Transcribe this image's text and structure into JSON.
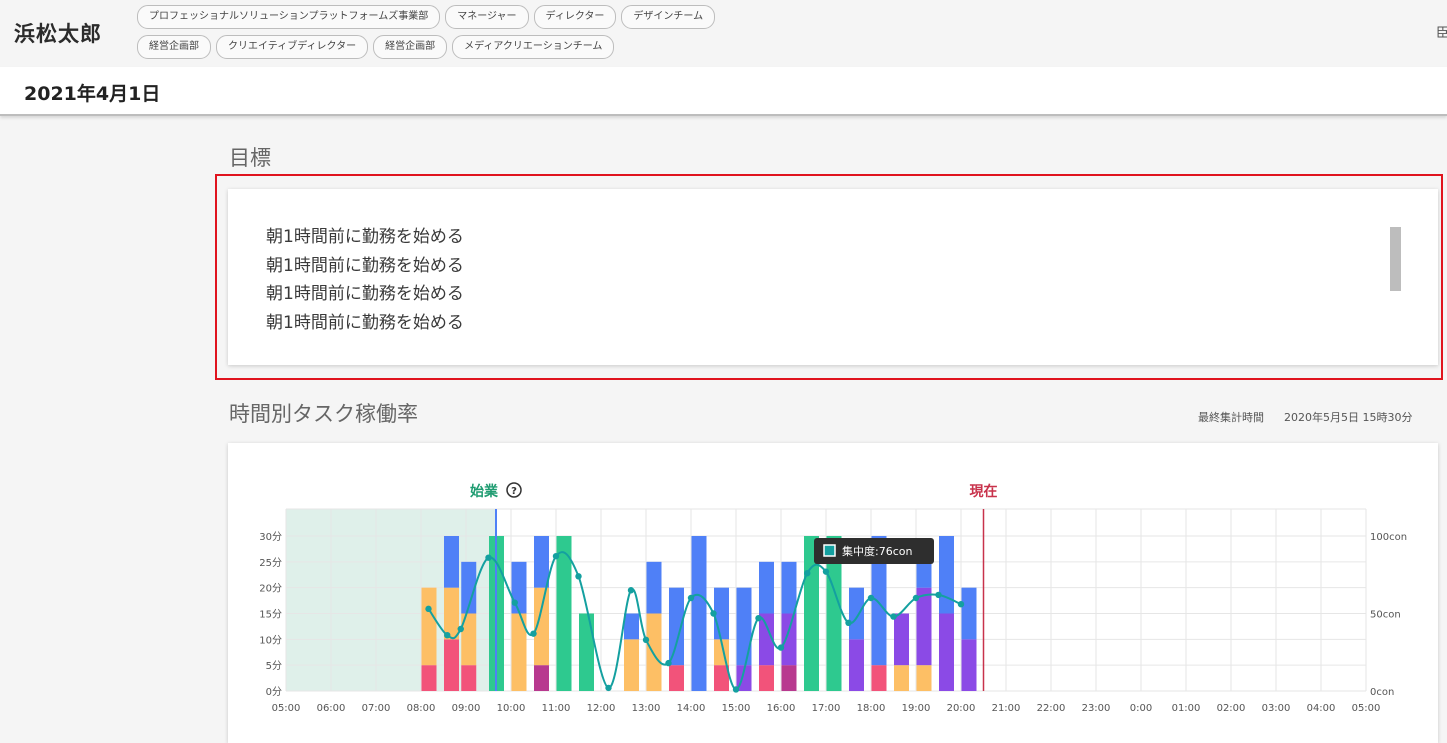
{
  "header": {
    "user_name": "浜松太郎",
    "tags_row1": [
      "プロフェッショナルソリューションプラットフォームズ事業部",
      "マネージャー",
      "ディレクター",
      "デザインチーム"
    ],
    "tags_row2": [
      "経営企画部",
      "クリエイティブディレクター",
      "経営企画部",
      "メディアクリエーションチーム"
    ],
    "edge_glyph": "臣"
  },
  "date": "2021年4月1日",
  "goals": {
    "title": "目標",
    "items": [
      "朝1時間前に勤務を始める",
      "朝1時間前に勤務を始める",
      "朝1時間前に勤務を始める",
      "朝1時間前に勤務を始める"
    ]
  },
  "task_rate": {
    "title": "時間別タスク稼働率",
    "last_updated_label": "最終集計時間",
    "last_updated_value": "2020年5月5日 15時30分"
  },
  "colors": {
    "pink": "#f2537a",
    "orange": "#fdbf65",
    "blue": "#4f80f7",
    "green": "#2ec98f",
    "purple": "#8b4ae6",
    "magenta": "#b8398f",
    "teal": "#14a0a0",
    "shade": "#dff0ea",
    "start_marker": "#1f9c71",
    "now_marker": "#c8324b"
  },
  "chart_data": {
    "type": "bar",
    "markers": {
      "start_label": "始業",
      "start_help_icon": "question-circle-icon",
      "start_time": "09:40",
      "now_label": "現在",
      "now_time": "20:30"
    },
    "tooltip": "集中度:76con",
    "x_ticks": [
      "05:00",
      "06:00",
      "07:00",
      "08:00",
      "09:00",
      "10:00",
      "11:00",
      "12:00",
      "13:00",
      "14:00",
      "15:00",
      "16:00",
      "17:00",
      "18:00",
      "19:00",
      "20:00",
      "21:00",
      "22:00",
      "23:00",
      "0:00",
      "01:00",
      "02:00",
      "03:00",
      "04:00",
      "05:00"
    ],
    "y_left_ticks": [
      "0分",
      "5分",
      "10分",
      "15分",
      "20分",
      "25分",
      "30分"
    ],
    "y_left_range": [
      0,
      30
    ],
    "y_right_ticks": [
      "0con",
      "50con",
      "100con"
    ],
    "y_right_range": [
      0,
      100
    ],
    "shaded_until": "09:40",
    "bars": [
      {
        "time": "08:00",
        "segments": [
          [
            "pink",
            5
          ],
          [
            "orange",
            15
          ]
        ]
      },
      {
        "time": "08:30",
        "segments": [
          [
            "pink",
            10
          ],
          [
            "orange",
            10
          ],
          [
            "blue",
            10
          ]
        ]
      },
      {
        "time": "08:53",
        "segments": [
          [
            "pink",
            5
          ],
          [
            "orange",
            10
          ],
          [
            "blue",
            10
          ]
        ]
      },
      {
        "time": "09:30",
        "segments": [
          [
            "green",
            30
          ]
        ]
      },
      {
        "time": "10:00",
        "segments": [
          [
            "orange",
            15
          ],
          [
            "blue",
            10
          ]
        ]
      },
      {
        "time": "10:30",
        "segments": [
          [
            "magenta",
            5
          ],
          [
            "orange",
            15
          ],
          [
            "blue",
            10
          ]
        ]
      },
      {
        "time": "11:00",
        "segments": [
          [
            "green",
            30
          ]
        ]
      },
      {
        "time": "11:30",
        "segments": [
          [
            "green",
            15
          ]
        ]
      },
      {
        "time": "12:30",
        "segments": [
          [
            "orange",
            10
          ],
          [
            "blue",
            5
          ]
        ]
      },
      {
        "time": "13:00",
        "segments": [
          [
            "orange",
            15
          ],
          [
            "blue",
            10
          ]
        ]
      },
      {
        "time": "13:30",
        "segments": [
          [
            "pink",
            5
          ],
          [
            "blue",
            15
          ]
        ]
      },
      {
        "time": "14:00",
        "segments": [
          [
            "blue",
            30
          ]
        ]
      },
      {
        "time": "14:30",
        "segments": [
          [
            "pink",
            5
          ],
          [
            "orange",
            5
          ],
          [
            "blue",
            10
          ]
        ]
      },
      {
        "time": "15:00",
        "segments": [
          [
            "purple",
            5
          ],
          [
            "blue",
            15
          ]
        ]
      },
      {
        "time": "15:30",
        "segments": [
          [
            "pink",
            5
          ],
          [
            "purple",
            10
          ],
          [
            "blue",
            10
          ]
        ]
      },
      {
        "time": "16:00",
        "segments": [
          [
            "magenta",
            5
          ],
          [
            "purple",
            10
          ],
          [
            "blue",
            10
          ]
        ]
      },
      {
        "time": "16:30",
        "segments": [
          [
            "green",
            30
          ]
        ]
      },
      {
        "time": "17:00",
        "segments": [
          [
            "green",
            30
          ]
        ]
      },
      {
        "time": "17:30",
        "segments": [
          [
            "purple",
            10
          ],
          [
            "blue",
            10
          ]
        ]
      },
      {
        "time": "18:00",
        "segments": [
          [
            "pink",
            5
          ],
          [
            "blue",
            25
          ]
        ]
      },
      {
        "time": "18:30",
        "segments": [
          [
            "orange",
            5
          ],
          [
            "purple",
            10
          ]
        ]
      },
      {
        "time": "19:00",
        "segments": [
          [
            "orange",
            5
          ],
          [
            "purple",
            15
          ],
          [
            "blue",
            5
          ]
        ]
      },
      {
        "time": "19:30",
        "segments": [
          [
            "purple",
            15
          ],
          [
            "blue",
            15
          ]
        ]
      },
      {
        "time": "20:00",
        "segments": [
          [
            "purple",
            10
          ],
          [
            "blue",
            10
          ]
        ]
      }
    ],
    "concentration_line": {
      "name": "集中度",
      "points": [
        [
          "08:10",
          53
        ],
        [
          "08:35",
          36
        ],
        [
          "08:53",
          40
        ],
        [
          "09:30",
          86
        ],
        [
          "10:05",
          57
        ],
        [
          "10:30",
          37
        ],
        [
          "11:00",
          87
        ],
        [
          "11:30",
          74
        ],
        [
          "12:10",
          2
        ],
        [
          "12:40",
          65
        ],
        [
          "13:00",
          33
        ],
        [
          "13:30",
          18
        ],
        [
          "14:00",
          60
        ],
        [
          "14:30",
          50
        ],
        [
          "15:00",
          1
        ],
        [
          "15:30",
          47
        ],
        [
          "16:00",
          28
        ],
        [
          "16:35",
          76
        ],
        [
          "17:00",
          77
        ],
        [
          "17:30",
          44
        ],
        [
          "18:00",
          60
        ],
        [
          "18:30",
          48
        ],
        [
          "19:00",
          60
        ],
        [
          "19:30",
          62
        ],
        [
          "20:00",
          56
        ]
      ]
    }
  }
}
